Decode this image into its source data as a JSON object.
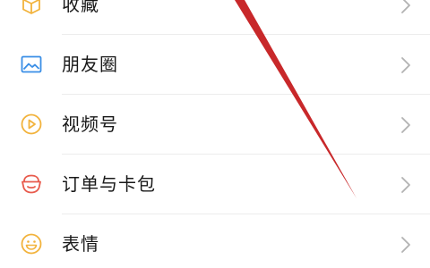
{
  "menu": {
    "items": [
      {
        "label": "收藏",
        "icon": "favorites-cube-icon",
        "color": "#f2b33d"
      },
      {
        "label": "朋友圈",
        "icon": "moments-picture-icon",
        "color": "#3a8ee6"
      },
      {
        "label": "视频号",
        "icon": "channels-play-icon",
        "color": "#f2b33d"
      },
      {
        "label": "订单与卡包",
        "icon": "orders-cards-icon",
        "color": "#e85b4d"
      },
      {
        "label": "表情",
        "icon": "stickers-smile-icon",
        "color": "#f2b33d"
      }
    ],
    "chevron_icon": "chevron-right-icon",
    "chevron_color": "#b2b2b2"
  },
  "annotation": {
    "arrow_color": "#c8282a"
  }
}
